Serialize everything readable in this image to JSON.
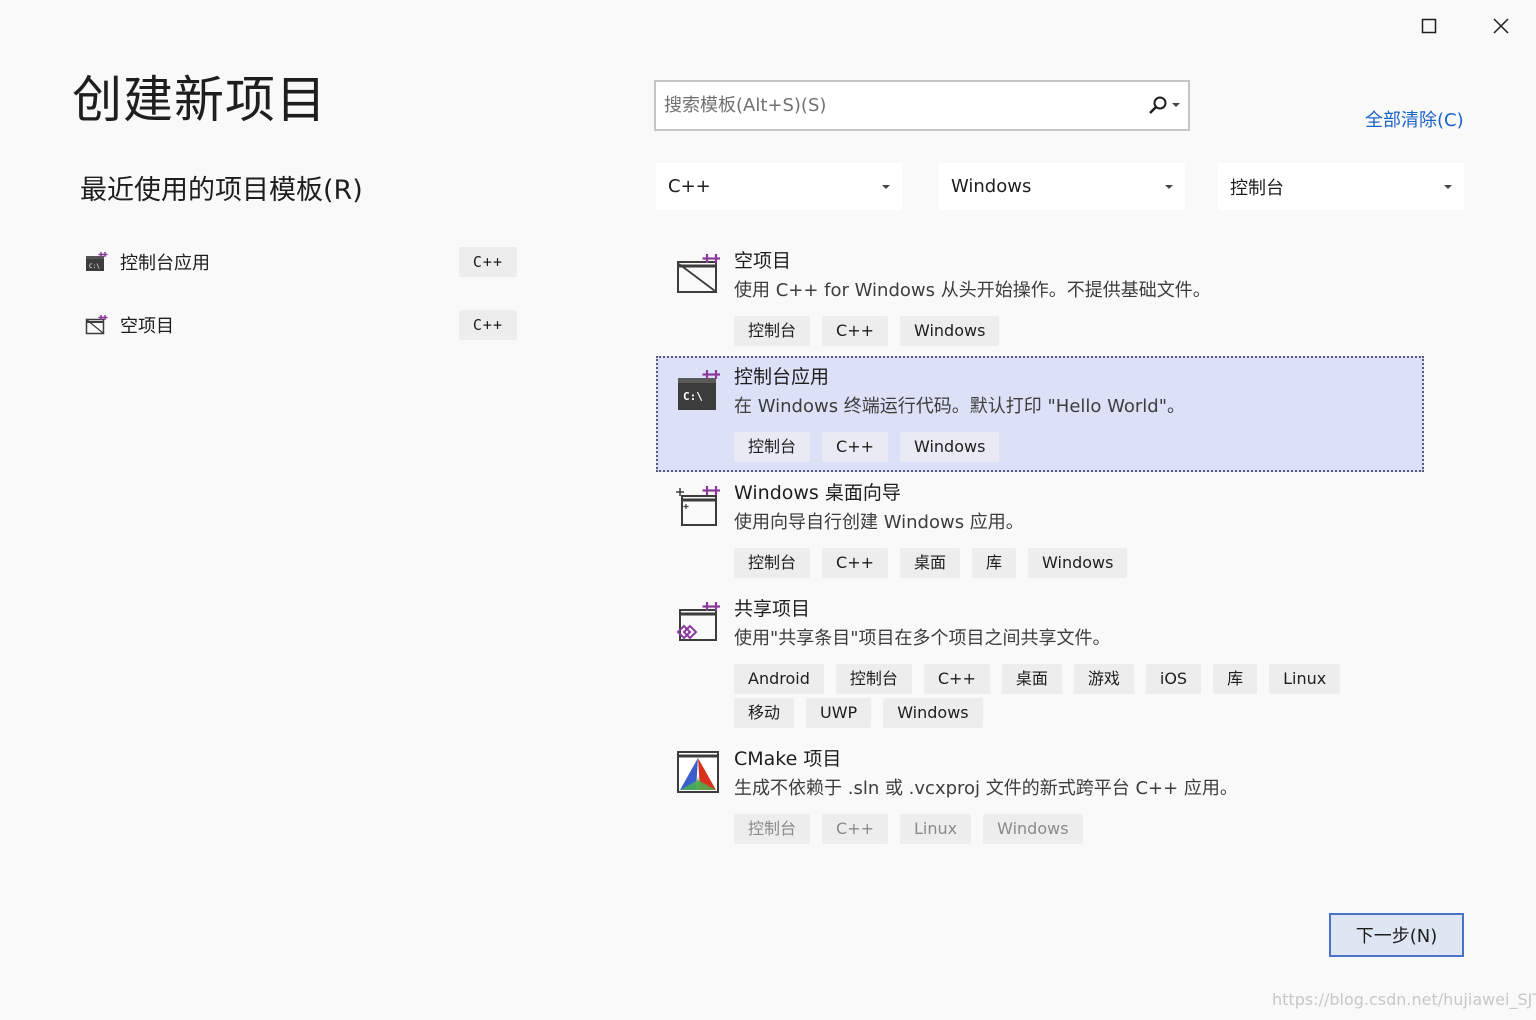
{
  "window": {
    "maximize_icon": "maximize-icon",
    "close_icon": "close-icon"
  },
  "title": "创建新项目",
  "recent": {
    "header": "最近使用的项目模板(R)",
    "items": [
      {
        "label": "控制台应用",
        "tag": "C++",
        "icon": "console-app-icon"
      },
      {
        "label": "空项目",
        "tag": "C++",
        "icon": "empty-project-icon"
      }
    ]
  },
  "search": {
    "placeholder": "搜索模板(Alt+S)(S)",
    "icon": "search-icon"
  },
  "clear_all": "全部清除(C)",
  "filters": {
    "language": "C++",
    "platform": "Windows",
    "project_type": "控制台"
  },
  "templates": [
    {
      "name": "空项目",
      "description": "使用 C++ for Windows 从头开始操作。不提供基础文件。",
      "tags": [
        "控制台",
        "C++",
        "Windows"
      ],
      "icon": "empty-project-icon"
    },
    {
      "name": "控制台应用",
      "description": "在 Windows 终端运行代码。默认打印 \"Hello World\"。",
      "tags": [
        "控制台",
        "C++",
        "Windows"
      ],
      "icon": "console-app-icon"
    },
    {
      "name": "Windows 桌面向导",
      "description": "使用向导自行创建 Windows 应用。",
      "tags": [
        "控制台",
        "C++",
        "桌面",
        "库",
        "Windows"
      ],
      "icon": "desktop-wizard-icon"
    },
    {
      "name": "共享项目",
      "description": "使用\"共享条目\"项目在多个项目之间共享文件。",
      "tags": [
        "Android",
        "控制台",
        "C++",
        "桌面",
        "游戏",
        "iOS",
        "库",
        "Linux",
        "移动",
        "UWP",
        "Windows"
      ],
      "icon": "shared-project-icon"
    },
    {
      "name": "CMake 项目",
      "description": "生成不依赖于 .sln 或 .vcxproj 文件的新式跨平台 C++ 应用。",
      "tags": [
        "控制台",
        "C++",
        "Linux",
        "Windows"
      ],
      "icon": "cmake-icon"
    }
  ],
  "next_button": "下一步(N)",
  "watermark": "https://blog.csdn.net/hujiawei_SJTU",
  "colors": {
    "background": "#f9f9f9",
    "selected_bg": "#dde1f7",
    "link": "#1a64c8",
    "accent_purple": "#8b3a9b"
  }
}
